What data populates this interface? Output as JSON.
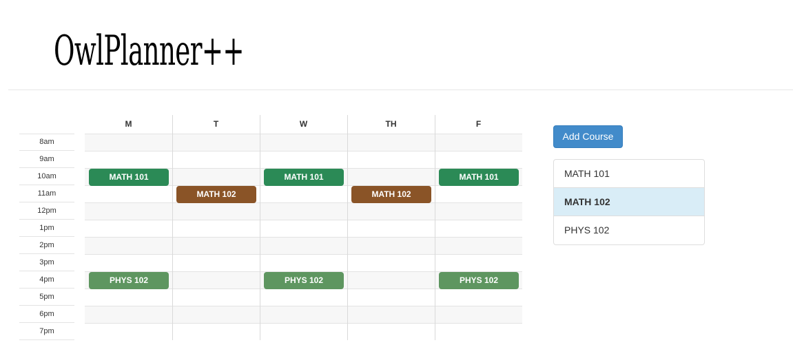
{
  "app": {
    "title": "OwlPlanner++"
  },
  "schedule": {
    "days": [
      "M",
      "T",
      "W",
      "TH",
      "F"
    ],
    "times": [
      "8am",
      "9am",
      "10am",
      "11am",
      "12pm",
      "1pm",
      "2pm",
      "3pm",
      "4pm",
      "5pm",
      "6pm",
      "7pm"
    ],
    "events": [
      {
        "course": "MATH 101",
        "day": "M",
        "time": "10am",
        "color": "#2b8a56"
      },
      {
        "course": "MATH 101",
        "day": "W",
        "time": "10am",
        "color": "#2b8a56"
      },
      {
        "course": "MATH 101",
        "day": "F",
        "time": "10am",
        "color": "#2b8a56"
      },
      {
        "course": "MATH 102",
        "day": "T",
        "time": "11am",
        "color": "#8a5427"
      },
      {
        "course": "MATH 102",
        "day": "TH",
        "time": "11am",
        "color": "#8a5427"
      },
      {
        "course": "PHYS 102",
        "day": "M",
        "time": "4pm",
        "color": "#5e9660"
      },
      {
        "course": "PHYS 102",
        "day": "W",
        "time": "4pm",
        "color": "#5e9660"
      },
      {
        "course": "PHYS 102",
        "day": "F",
        "time": "4pm",
        "color": "#5e9660"
      }
    ]
  },
  "sidebar": {
    "add_button_label": "Add Course",
    "courses": [
      {
        "label": "MATH 101",
        "selected": false
      },
      {
        "label": "MATH 102",
        "selected": true
      },
      {
        "label": "PHYS 102",
        "selected": false
      }
    ]
  }
}
